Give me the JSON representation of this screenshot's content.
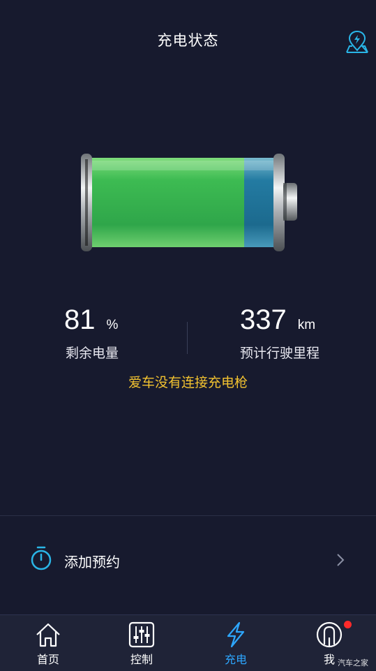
{
  "header": {
    "title": "充电状态",
    "map_icon": "charging-map-icon"
  },
  "battery": {
    "level_percent": 81,
    "fill_color": "#3fbf55",
    "empty_color": "#1e7fa6"
  },
  "stats": {
    "battery": {
      "value": "81",
      "unit": "%",
      "label": "剩余电量"
    },
    "range": {
      "value": "337",
      "unit": "km",
      "label": "预计行驶里程"
    }
  },
  "notice": "爱车没有连接充电枪",
  "reserve": {
    "icon": "timer-icon",
    "label": "添加预约"
  },
  "tabs": [
    {
      "label": "首页",
      "icon": "home-icon",
      "active": false
    },
    {
      "label": "控制",
      "icon": "sliders-icon",
      "active": false
    },
    {
      "label": "充电",
      "icon": "lightning-icon",
      "active": true
    },
    {
      "label": "我",
      "icon": "profile-icon",
      "active": false,
      "badge": true
    }
  ],
  "watermark": "汽车之家",
  "colors": {
    "background": "#171a2e",
    "accent": "#2da7ff",
    "warning_text": "#f2c230",
    "badge": "#ff2a2a"
  }
}
